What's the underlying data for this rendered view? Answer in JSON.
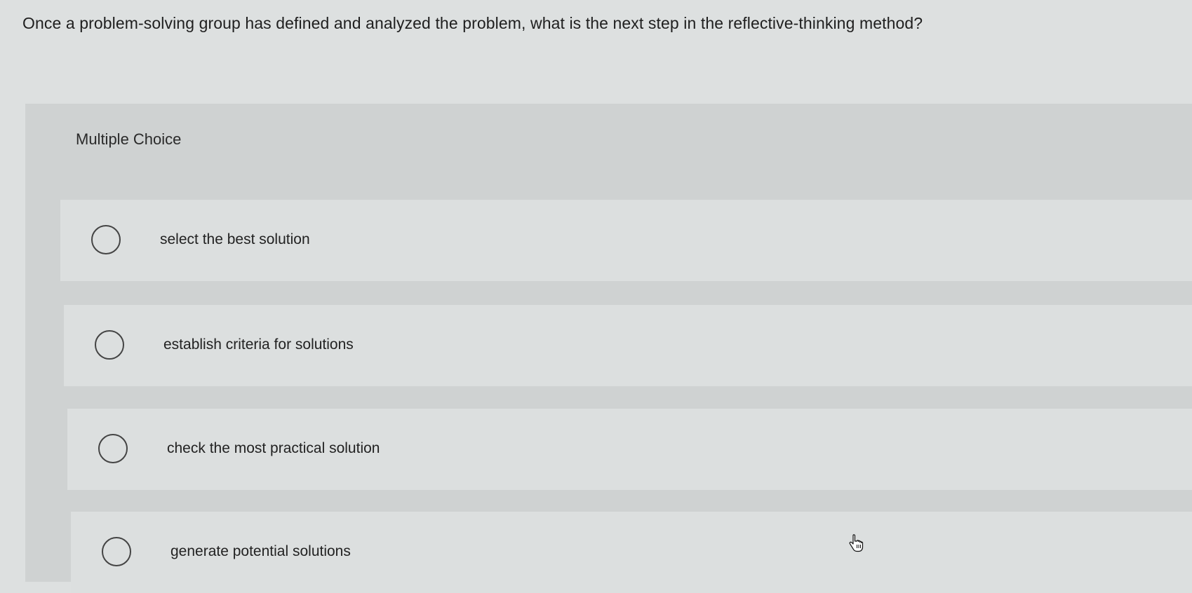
{
  "question": {
    "text": "Once a problem-solving group has defined and analyzed the problem, what is the next step in the reflective-thinking method?"
  },
  "question_type": {
    "label": "Multiple Choice"
  },
  "options": [
    {
      "label": "select the best solution",
      "selected": false
    },
    {
      "label": "establish criteria for solutions",
      "selected": false
    },
    {
      "label": "check the most practical solution",
      "selected": false
    },
    {
      "label": "generate potential solutions",
      "selected": false
    }
  ],
  "cursor": {
    "icon": "hand-pointer-icon"
  }
}
